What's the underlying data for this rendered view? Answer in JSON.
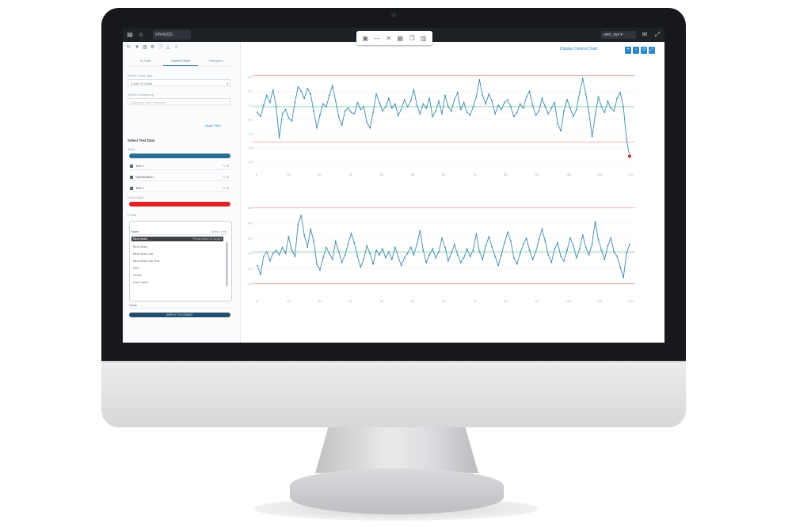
{
  "app": {
    "tab_title": "InfinityQS",
    "user_label": "user_sys ▾"
  },
  "left_panel": {
    "tabs": [
      {
        "label": "All Data"
      },
      {
        "label": "Control Chart"
      },
      {
        "label": "Histogram"
      }
    ],
    "field1_label": "Select Chart Type",
    "field1_value": "X-bar / R Chart",
    "field2_label": "Select a Subgroup",
    "field2_value": "Subgroup Size / Number",
    "link_text": "Apply Filter",
    "section_title": "Select Test Data",
    "label_tests": "Tests",
    "items": [
      {
        "label": "Test 1"
      },
      {
        "label": "Specification"
      },
      {
        "label": "Test 2"
      }
    ],
    "label_limits": "Limits Data",
    "label_points": "Points",
    "dropdown": {
      "header": "None",
      "header_hint": "Select Test",
      "selected": "Blue Mark",
      "selected_hint": "Press enter to select",
      "options": [
        "Blue Mark",
        "Blue Mark Cal",
        "Blue Mark Cal Test",
        "Red",
        "Green",
        "Limit Value"
      ]
    },
    "bottom_row": "Value",
    "button_label": "APPLY TO CHART"
  },
  "header_link": "Display Control Chart",
  "colors": {
    "accent": "#2c87c5",
    "red_bar": "#e12124",
    "navy": "#234d6b",
    "line": "#3e8bb0",
    "limit": "#f2a3a3",
    "center": "#8fd3a6"
  },
  "chart_data": [
    {
      "type": "line",
      "x": [
        1,
        2,
        3,
        4,
        5,
        6,
        7,
        8,
        9,
        10,
        11,
        12,
        13,
        14,
        15,
        16,
        17,
        18,
        19,
        20,
        21,
        22,
        23,
        24,
        25,
        26,
        27,
        28,
        29,
        30,
        31,
        32,
        33,
        34,
        35,
        36,
        37,
        38,
        39,
        40,
        41,
        42,
        43,
        44,
        45,
        46,
        47,
        48,
        49,
        50,
        51,
        52,
        53,
        54,
        55,
        56,
        57,
        58,
        59,
        60,
        61,
        62,
        63,
        64,
        65,
        66,
        67,
        68,
        69,
        70,
        71,
        72,
        73,
        74,
        75,
        76,
        77,
        78,
        79,
        80,
        81,
        82,
        83,
        84,
        85,
        86,
        87,
        88,
        89,
        90,
        91,
        92,
        93,
        94,
        95,
        96,
        97,
        98,
        99,
        100,
        101,
        102,
        103,
        104,
        105,
        106,
        107,
        108,
        109,
        110,
        111,
        112,
        113,
        114,
        115,
        116,
        117,
        118,
        119,
        120
      ],
      "series": [
        {
          "values": [
            0.5,
            0.2,
            1.0,
            1.7,
            1.2,
            2.1,
            0.9,
            -1.3,
            0.4,
            0.7,
            0.1,
            -0.1,
            1.2,
            2.3,
            2.0,
            1.5,
            2.2,
            1.8,
            0.6,
            -0.6,
            0.3,
            1.1,
            0.9,
            1.7,
            2.4,
            1.3,
            0.2,
            -0.4,
            0.6,
            0.8,
            0.5,
            0.4,
            1.2,
            0.7,
            0.9,
            -0.2,
            -0.6,
            0.5,
            1.8,
            1.2,
            0.6,
            0.9,
            1.5,
            0.8,
            1.1,
            0.3,
            0.7,
            1.4,
            0.9,
            1.3,
            2.1,
            1.0,
            0.4,
            1.1,
            0.8,
            1.5,
            0.2,
            0.6,
            1.3,
            0.4,
            1.7,
            0.9,
            0.6,
            1.4,
            1.9,
            0.7,
            1.2,
            0.5,
            0.3,
            0.9,
            1.6,
            2.8,
            1.7,
            1.1,
            1.8,
            1.3,
            0.4,
            1.0,
            0.7,
            1.2,
            1.4,
            0.9,
            0.2,
            0.5,
            1.1,
            0.8,
            1.6,
            2.0,
            1.0,
            0.3,
            0.6,
            1.5,
            0.9,
            0.4,
            0.8,
            1.2,
            -0.3,
            -0.8,
            0.6,
            1.4,
            0.8,
            0.2,
            0.7,
            1.9,
            2.9,
            1.8,
            0.5,
            -1.2,
            0.3,
            1.6,
            0.9,
            0.5,
            1.3,
            0.8,
            0.6,
            1.5,
            1.9,
            0.9,
            -1.4,
            -2.6
          ],
          "marker_color": "#3e8bb0"
        }
      ],
      "special_points": [
        {
          "x": 120,
          "y": -2.6,
          "color": "#e12124"
        }
      ],
      "ucl": 3.1,
      "cl": 0.9,
      "lcl": -1.6,
      "ylim": [
        -3.3,
        3.3
      ],
      "yticks": [
        "3.0",
        "2.0",
        "1.0",
        "0.0",
        "-1.0",
        "-2.0",
        "-3.0"
      ],
      "xticks": [
        "0",
        "10",
        "20",
        "30",
        "40",
        "50",
        "60",
        "70",
        "80",
        "90",
        "100",
        "110",
        "120"
      ]
    },
    {
      "type": "line",
      "x": [
        1,
        2,
        3,
        4,
        5,
        6,
        7,
        8,
        9,
        10,
        11,
        12,
        13,
        14,
        15,
        16,
        17,
        18,
        19,
        20,
        21,
        22,
        23,
        24,
        25,
        26,
        27,
        28,
        29,
        30,
        31,
        32,
        33,
        34,
        35,
        36,
        37,
        38,
        39,
        40,
        41,
        42,
        43,
        44,
        45,
        46,
        47,
        48,
        49,
        50,
        51,
        52,
        53,
        54,
        55,
        56,
        57,
        58,
        59,
        60,
        61,
        62,
        63,
        64,
        65,
        66,
        67,
        68,
        69,
        70,
        71,
        72,
        73,
        74,
        75,
        76,
        77,
        78,
        79,
        80,
        81,
        82,
        83,
        84,
        85,
        86,
        87,
        88,
        89,
        90,
        91,
        92,
        93,
        94,
        95,
        96,
        97,
        98,
        99,
        100,
        101,
        102,
        103,
        104,
        105,
        106,
        107,
        108,
        109,
        110,
        111,
        112,
        113,
        114,
        115,
        116,
        117,
        118,
        119,
        120
      ],
      "series": [
        {
          "values": [
            1.2,
            0.6,
            1.8,
            2.1,
            1.5,
            2.0,
            2.2,
            1.9,
            2.4,
            2.0,
            3.1,
            2.2,
            1.8,
            3.9,
            4.5,
            3.2,
            2.4,
            3.6,
            2.8,
            1.3,
            0.9,
            1.7,
            2.4,
            2.0,
            1.6,
            2.8,
            2.1,
            1.4,
            1.9,
            2.6,
            3.3,
            2.7,
            1.8,
            1.1,
            1.6,
            2.5,
            2.0,
            1.3,
            2.2,
            1.9,
            2.3,
            1.7,
            2.1,
            1.6,
            2.4,
            1.8,
            1.2,
            1.7,
            2.0,
            2.4,
            1.9,
            2.6,
            3.5,
            2.2,
            1.4,
            1.9,
            2.3,
            1.7,
            2.1,
            3.0,
            2.4,
            1.5,
            2.0,
            2.6,
            1.9,
            1.4,
            1.7,
            2.3,
            1.8,
            2.2,
            3.3,
            2.1,
            1.6,
            2.5,
            3.1,
            2.4,
            1.8,
            1.2,
            1.9,
            2.7,
            3.4,
            2.8,
            1.7,
            1.3,
            2.0,
            2.6,
            3.0,
            2.2,
            1.6,
            2.1,
            2.9,
            3.6,
            2.8,
            1.9,
            1.4,
            2.3,
            2.7,
            1.8,
            1.5,
            2.2,
            3.0,
            2.5,
            1.7,
            2.3,
            3.2,
            2.4,
            1.9,
            2.6,
            4.1,
            2.9,
            2.2,
            1.6,
            2.5,
            3.0,
            2.1,
            1.8,
            1.1,
            0.4,
            2.0,
            2.6
          ],
          "marker_color": "#3e8bb0"
        }
      ],
      "ucl": 5.0,
      "cl": 2.1,
      "lcl": 0.0,
      "ylim": [
        -0.6,
        5.4
      ],
      "yticks": [
        "5.0",
        "4.0",
        "3.0",
        "2.0",
        "1.0",
        "0.0"
      ],
      "xticks": [
        "0",
        "10",
        "20",
        "30",
        "40",
        "50",
        "60",
        "70",
        "80",
        "90",
        "100",
        "110",
        "120"
      ]
    }
  ]
}
